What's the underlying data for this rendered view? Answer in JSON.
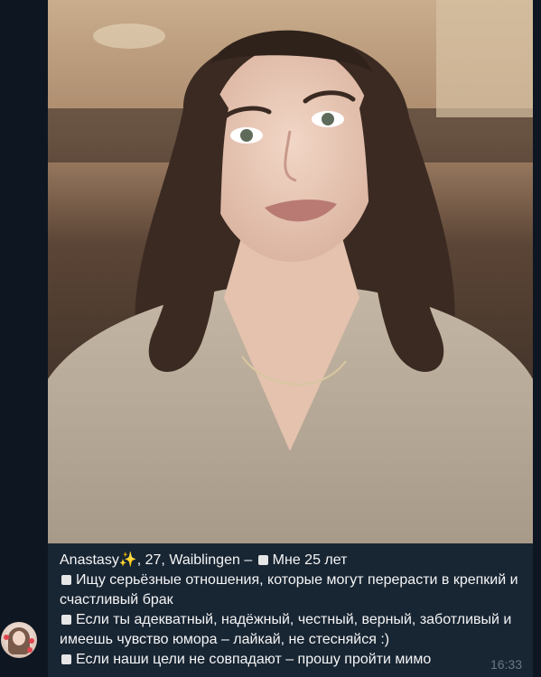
{
  "message": {
    "name": "Anastasy",
    "sparkle": "✨",
    "age_city": ", 27, Waiblingen –",
    "lines": [
      "Мне 25 лет",
      "Ищу серьёзные отношения, которые могут перерасти в крепкий и счастливый брак",
      "Если ты адекватный, надёжный, честный, верный, заботливый и имеешь чувство юмора – лайкай, не стесняйся :)",
      "Если наши цели не совпадают – прошу пройти мимо"
    ],
    "time": "16:33"
  },
  "colors": {
    "background": "#0e1621",
    "bubble": "#182533",
    "text": "#f5f5f5",
    "time": "#6c7883"
  }
}
